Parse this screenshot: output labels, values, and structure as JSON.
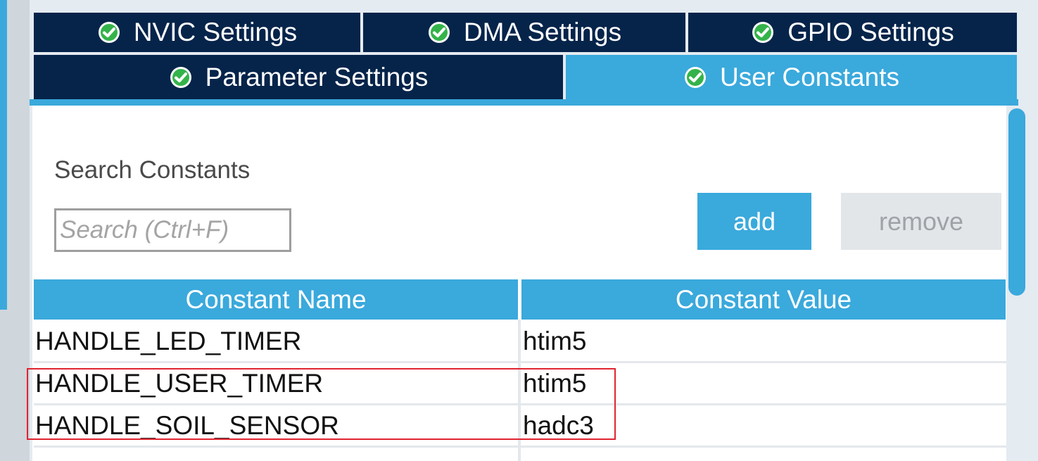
{
  "tabs_row1": [
    {
      "label": "NVIC Settings",
      "active": false
    },
    {
      "label": "DMA Settings",
      "active": false
    },
    {
      "label": "GPIO Settings",
      "active": false
    }
  ],
  "tabs_row2": [
    {
      "label": "Parameter Settings",
      "active": false
    },
    {
      "label": "User Constants",
      "active": true
    }
  ],
  "tab_icon": "check-circle-icon",
  "colors": {
    "tab_dark": "#06244a",
    "accent": "#3aa9dc",
    "check_green": "#34b34a",
    "highlight_red": "#e0242f"
  },
  "search": {
    "title": "Search Constants",
    "placeholder": "Search (Ctrl+F)",
    "value": ""
  },
  "buttons": {
    "add": "add",
    "remove": "remove"
  },
  "table": {
    "headers": [
      "Constant Name",
      "Constant Value"
    ],
    "rows": [
      {
        "name": "HANDLE_LED_TIMER",
        "value": "htim5"
      },
      {
        "name": "HANDLE_USER_TIMER",
        "value": "htim5"
      },
      {
        "name": "HANDLE_SOIL_SENSOR",
        "value": "hadc3"
      }
    ]
  }
}
